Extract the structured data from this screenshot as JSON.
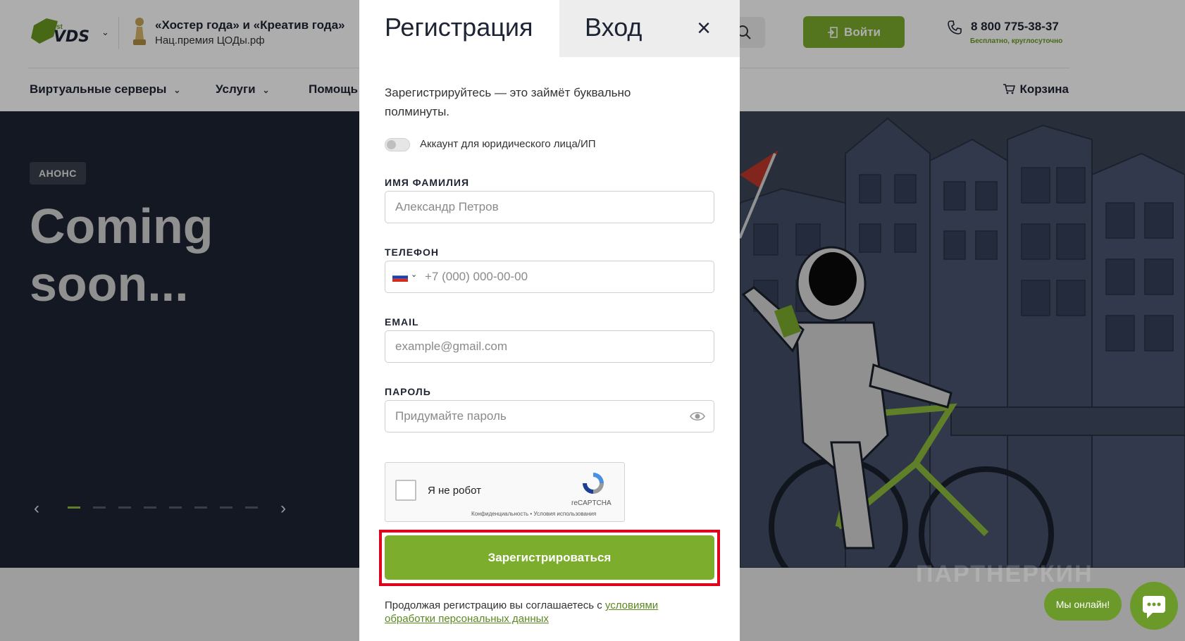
{
  "header": {
    "logo_text": "VDS",
    "logo_sup": "st",
    "award_title": "«Хостер года» и «Креатив года»",
    "award_subtitle": "Нац.премия ЦОДы.рф",
    "login_label": "Войти",
    "phone": "8 800 775-38-37",
    "phone_note": "Бесплатно, круглосуточно"
  },
  "nav": {
    "items": [
      {
        "label": "Виртуальные серверы",
        "has_dropdown": true
      },
      {
        "label": "Услуги",
        "has_dropdown": true
      },
      {
        "label": "Помощь"
      }
    ],
    "cart_label": "Корзина"
  },
  "hero": {
    "badge": "АНОНС",
    "title": "Coming soon...",
    "slide_count": 8,
    "active_slide": 1
  },
  "modal": {
    "tab_register": "Регистрация",
    "tab_login": "Вход",
    "close": "×",
    "intro": "Зарегистрируйтесь — это займёт буквально полминуты.",
    "legal_toggle_label": "Аккаунт для юридического лица/ИП",
    "legal_toggle_on": false,
    "fields": {
      "name": {
        "label": "ИМЯ ФАМИЛИЯ",
        "placeholder": "Александр Петров",
        "value": ""
      },
      "phone": {
        "label": "ТЕЛЕФОН",
        "placeholder": "+7 (000) 000-00-00",
        "value": ""
      },
      "email": {
        "label": "EMAIL",
        "placeholder": "example@gmail.com",
        "value": ""
      },
      "password": {
        "label": "ПАРОЛЬ",
        "placeholder": "Придумайте пароль",
        "value": ""
      }
    },
    "captcha": {
      "label": "Я не робот",
      "brand": "reCAPTCHA",
      "links": "Конфиденциальность • Условия использования",
      "checked": false
    },
    "register_button": "Зарегистрироваться",
    "terms_text": "Продолжая регистрацию вы соглашаетесь с ",
    "terms_link": "условиями обработки персональных данных"
  },
  "widgets": {
    "online_label": "Мы онлайн!",
    "watermark": "ПАРТНЕРКИН"
  },
  "colors": {
    "accent_green": "#7cad2d",
    "hero_dark": "#1d2433",
    "highlight_red": "#e0001b"
  }
}
